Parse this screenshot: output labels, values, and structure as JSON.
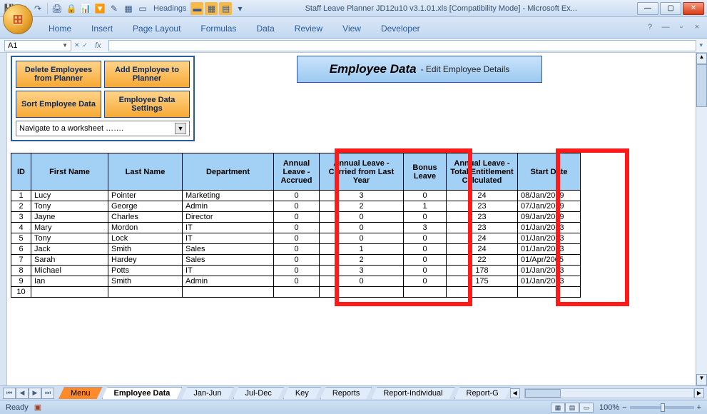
{
  "window": {
    "title": "Staff Leave Planner JD12u10 v3.1.01.xls  [Compatibility Mode] - Microsoft Ex...",
    "headings_label": "Headings"
  },
  "ribbon": {
    "tabs": [
      "Home",
      "Insert",
      "Page Layout",
      "Formulas",
      "Data",
      "Review",
      "View",
      "Developer"
    ]
  },
  "namebox": "A1",
  "buttons": {
    "delete": "Delete Employees from Planner",
    "add": "Add Employee to Planner",
    "sort": "Sort  Employee Data",
    "settings": "Employee Data Settings"
  },
  "nav_combo": "Navigate to a worksheet …….",
  "banner": {
    "big": "Employee Data",
    "sub": "- Edit Employee Details"
  },
  "columns": {
    "id": "ID",
    "first": "First Name",
    "last": "Last Name",
    "dept": "Department",
    "accrued": "Annual Leave - Accrued",
    "carried": "Annual Leave - Carried from Last Year",
    "bonus": "Bonus Leave",
    "total": "Annual Leave - Total Entitlement Calculated",
    "start": "Start Date"
  },
  "rows": [
    {
      "id": "1",
      "first": "Lucy",
      "last": "Pointer",
      "dept": "Marketing",
      "accrued": "0",
      "carried": "3",
      "bonus": "0",
      "total": "24",
      "start": "08/Jan/2009"
    },
    {
      "id": "2",
      "first": "Tony",
      "last": "George",
      "dept": "Admin",
      "accrued": "0",
      "carried": "2",
      "bonus": "1",
      "total": "23",
      "start": "07/Jan/2009"
    },
    {
      "id": "3",
      "first": "Jayne",
      "last": "Charles",
      "dept": "Director",
      "accrued": "0",
      "carried": "0",
      "bonus": "0",
      "total": "23",
      "start": "09/Jan/2009"
    },
    {
      "id": "4",
      "first": "Mary",
      "last": "Mordon",
      "dept": "IT",
      "accrued": "0",
      "carried": "0",
      "bonus": "3",
      "total": "23",
      "start": "01/Jan/2003"
    },
    {
      "id": "5",
      "first": "Tony",
      "last": "Lock",
      "dept": "IT",
      "accrued": "0",
      "carried": "0",
      "bonus": "0",
      "total": "24",
      "start": "01/Jan/2003"
    },
    {
      "id": "6",
      "first": "Jack",
      "last": "Smith",
      "dept": "Sales",
      "accrued": "0",
      "carried": "1",
      "bonus": "0",
      "total": "24",
      "start": "01/Jan/2003"
    },
    {
      "id": "7",
      "first": "Sarah",
      "last": "Hardey",
      "dept": "Sales",
      "accrued": "0",
      "carried": "2",
      "bonus": "0",
      "total": "22",
      "start": "01/Apr/2005"
    },
    {
      "id": "8",
      "first": "Michael",
      "last": "Potts",
      "dept": "IT",
      "accrued": "0",
      "carried": "3",
      "bonus": "0",
      "total": "178",
      "start": "01/Jan/2003"
    },
    {
      "id": "9",
      "first": "Ian",
      "last": "Smith",
      "dept": "Admin",
      "accrued": "0",
      "carried": "0",
      "bonus": "0",
      "total": "175",
      "start": "01/Jan/2003"
    },
    {
      "id": "10",
      "first": "",
      "last": "",
      "dept": "",
      "accrued": "",
      "carried": "",
      "bonus": "",
      "total": "",
      "start": ""
    }
  ],
  "sheets": [
    "Menu",
    "Employee Data",
    "Jan-Jun",
    "Jul-Dec",
    "Key",
    "Reports",
    "Report-Individual",
    "Report-G"
  ],
  "active_sheet": 1,
  "status": {
    "ready": "Ready",
    "zoom": "100%"
  }
}
